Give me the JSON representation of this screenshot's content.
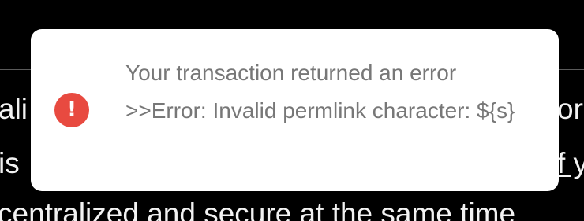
{
  "background": {
    "line1_left": "ali",
    "line1_right": "or",
    "line2_left": "is",
    "line2_right": "f y",
    "line3": "centralized and secure at the same time"
  },
  "toast": {
    "icon": "error-exclamation-icon",
    "icon_glyph": "!",
    "icon_color": "#e84a40",
    "message": "Your transaction returned an error >>Error: Invalid permlink character: ${s}"
  }
}
